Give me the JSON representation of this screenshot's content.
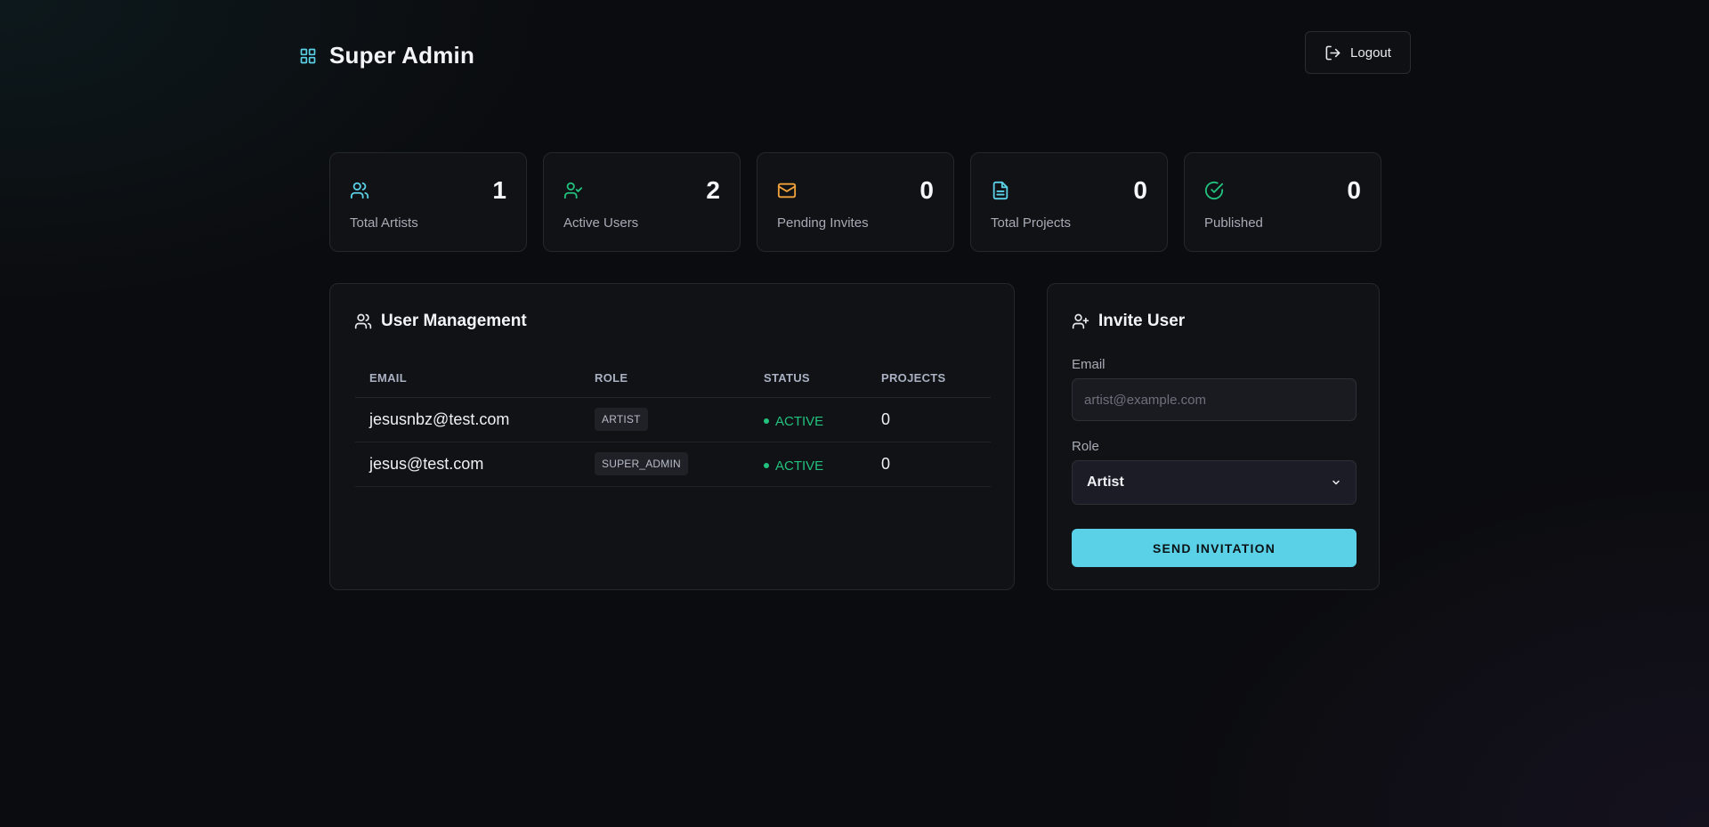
{
  "header": {
    "title": "Super Admin",
    "logout_label": "Logout"
  },
  "colors": {
    "accent": "#5ad1e6",
    "active": "#22c27e",
    "warning": "#f0a13a"
  },
  "stats": [
    {
      "icon": "users-icon",
      "value": "1",
      "label": "Total Artists"
    },
    {
      "icon": "user-check-icon",
      "value": "2",
      "label": "Active Users"
    },
    {
      "icon": "mail-icon",
      "value": "0",
      "label": "Pending Invites"
    },
    {
      "icon": "file-icon",
      "value": "0",
      "label": "Total Projects"
    },
    {
      "icon": "check-circle-icon",
      "value": "0",
      "label": "Published"
    }
  ],
  "user_management": {
    "title": "User Management",
    "columns": [
      "EMAIL",
      "ROLE",
      "STATUS",
      "PROJECTS"
    ],
    "rows": [
      {
        "email": "jesusnbz@test.com",
        "role": "ARTIST",
        "status": "ACTIVE",
        "projects": "0"
      },
      {
        "email": "jesus@test.com",
        "role": "SUPER_ADMIN",
        "status": "ACTIVE",
        "projects": "0"
      }
    ]
  },
  "invite": {
    "title": "Invite User",
    "email_label": "Email",
    "email_value": "",
    "email_placeholder": "artist@example.com",
    "role_label": "Role",
    "role_selected": "Artist",
    "submit_label": "SEND INVITATION"
  }
}
